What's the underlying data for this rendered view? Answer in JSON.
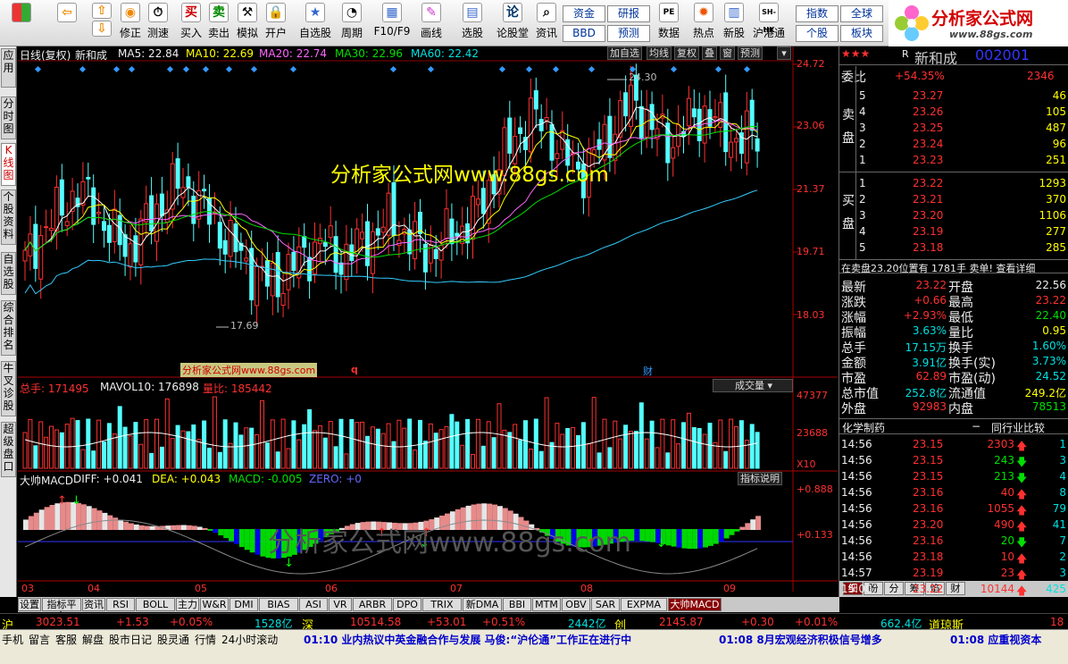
{
  "toolbar": {
    "buttons": [
      "修正",
      "测速",
      "买入",
      "卖出",
      "模拟",
      "开户",
      "自选股",
      "周期",
      "F10/F9",
      "画线",
      "选股",
      "论股堂",
      "资讯",
      "数据",
      "热点",
      "新股",
      "沪港通"
    ],
    "small": [
      "资金",
      "BBD",
      "研报",
      "预测",
      "指数",
      "个股",
      "全球",
      "板块"
    ]
  },
  "logo": {
    "title": "分析家公式网",
    "url": "www.88gs.com"
  },
  "left_tabs": [
    "应用",
    "分时图",
    "K线图",
    "个股资料",
    "自选股",
    "综合排名",
    "牛叉诊股",
    "超级盘口"
  ],
  "chart": {
    "header": {
      "label": "日线(复权)",
      "name": "新和成",
      "ma5": "MA5: 22.84",
      "ma10": "MA10: 22.69",
      "ma20": "MA20: 22.74",
      "ma30": "MA30: 22.96",
      "ma60": "MA60: 22.42"
    },
    "header_buttons": [
      "加自选",
      "均线",
      "复权",
      "叠",
      "窗",
      "预测"
    ],
    "price_axis": [
      "24.72",
      "23.06",
      "21.37",
      "19.71",
      "18.03"
    ],
    "high_label": "24.30",
    "low_label": "17.69",
    "watermark": "分析家公式网www.88gs.com",
    "watermark2": "分析家公式网www.88gs.com",
    "small_stamp": "分析家公式网www.88gs.com",
    "event_marks": [
      "q",
      "财"
    ],
    "volume": {
      "zongshou": "总手: 171495",
      "mavol": "MAVOL10: 176898",
      "liangbi": "量比: 185442",
      "menu": "成交量",
      "axis": [
        "47377",
        "23688",
        "X10"
      ]
    },
    "macd": {
      "title": "大帅MACD",
      "diff": "DIFF: +0.041",
      "dea": "DEA: +0.043",
      "macd": "MACD: -0.005",
      "zero": "ZERO: +0",
      "help": "指标说明",
      "axis": [
        "+0.888",
        "+0.133"
      ]
    },
    "months": [
      "03",
      "04",
      "05",
      "06",
      "07",
      "08",
      "09"
    ]
  },
  "chart_data": {
    "type": "candlestick",
    "title": "新和成 日线(复权)",
    "ylim": [
      17.0,
      25.0
    ],
    "high": 24.3,
    "low": 17.69,
    "months": [
      "03",
      "04",
      "05",
      "06",
      "07",
      "08",
      "09"
    ],
    "closes": [
      19.2,
      20.1,
      20.6,
      21.2,
      20.8,
      19.9,
      19.6,
      20.3,
      21.0,
      21.4,
      20.9,
      20.2,
      19.6,
      19.0,
      18.6,
      18.9,
      19.4,
      19.8,
      19.3,
      19.6,
      20.0,
      20.4,
      19.9,
      19.5,
      19.8,
      20.2,
      20.6,
      21.8,
      22.6,
      23.3,
      22.9,
      22.1,
      21.8,
      22.4,
      23.2,
      23.8,
      22.9,
      22.6,
      23.1,
      23.4,
      22.9,
      22.6,
      22.84
    ],
    "ma_lines": {
      "MA5": 22.84,
      "MA10": 22.69,
      "MA20": 22.74,
      "MA30": 22.96,
      "MA60": 22.42
    }
  },
  "right": {
    "stock_name": "新和成",
    "stock_code": "002001",
    "weibi_label": "委比",
    "weibi_val": "+54.35%",
    "weibi_num": "2346",
    "sell": [
      [
        "5",
        "23.27",
        "46"
      ],
      [
        "4",
        "23.26",
        "105"
      ],
      [
        "3",
        "23.25",
        "487"
      ],
      [
        "2",
        "23.24",
        "96"
      ],
      [
        "1",
        "23.23",
        "251"
      ]
    ],
    "buy": [
      [
        "1",
        "23.22",
        "1293"
      ],
      [
        "2",
        "23.21",
        "370"
      ],
      [
        "3",
        "23.20",
        "1106"
      ],
      [
        "4",
        "23.19",
        "277"
      ],
      [
        "5",
        "23.18",
        "285"
      ]
    ],
    "sell_label": "卖盘",
    "buy_label": "买盘",
    "notice": "在卖盘23.20位置有 1781手 卖单! 查看详细",
    "quote": [
      [
        "最新",
        "23.22",
        "开盘",
        "22.56"
      ],
      [
        "涨跌",
        "+0.66",
        "最高",
        "23.22"
      ],
      [
        "涨幅",
        "+2.93%",
        "最低",
        "22.40"
      ],
      [
        "振幅",
        "3.63%",
        "量比",
        "0.95"
      ],
      [
        "总手",
        "17.15万",
        "换手",
        "1.60%"
      ],
      [
        "金额",
        "3.91亿",
        "换手(实)",
        "3.73%"
      ],
      [
        "市盈",
        "62.89",
        "市盈(动)",
        "24.52"
      ],
      [
        "总市值",
        "252.8亿",
        "流通值",
        "249.2亿"
      ],
      [
        "外盘",
        "92983",
        "内盘",
        "78513"
      ]
    ],
    "industry": "化学制药",
    "industry_cmp": "同行业比较",
    "ticks": [
      [
        "14:56",
        "23.15",
        "2303",
        "1"
      ],
      [
        "14:56",
        "23.15",
        "243",
        "3"
      ],
      [
        "14:56",
        "23.15",
        "213",
        "4"
      ],
      [
        "14:56",
        "23.16",
        "40",
        "8"
      ],
      [
        "14:56",
        "23.16",
        "1055",
        "79"
      ],
      [
        "14:56",
        "23.20",
        "490",
        "41"
      ],
      [
        "14:56",
        "23.16",
        "20",
        "7"
      ],
      [
        "14:56",
        "23.18",
        "10",
        "2"
      ],
      [
        "14:57",
        "23.19",
        "23",
        "3"
      ],
      [
        "15:00",
        "23.22",
        "10144",
        "425"
      ]
    ],
    "bottom_tabs": [
      "细",
      "盼",
      "分",
      "筹",
      "焰",
      "财"
    ]
  },
  "bottom_tabs": [
    "设置",
    "指标平台",
    "资讯",
    "RSI",
    "BOLL",
    "主力",
    "W&R",
    "DMI",
    "BIAS",
    "ASI",
    "VR",
    "ARBR",
    "DPO",
    "TRIX",
    "新DMA",
    "BBI",
    "MTM",
    "OBV",
    "SAR",
    "EXPMA",
    "大帅MACD"
  ],
  "status1": {
    "sh_label": "沪",
    "sh": "3023.51",
    "sh_chg": "+1.53",
    "sh_pct": "+0.05%",
    "sh_amt": "1528亿",
    "sz_label": "深",
    "sz": "10514.58",
    "sz_chg": "+53.01",
    "sz_pct": "+0.51%",
    "sz_amt": "2442亿",
    "cy_label": "创",
    "cy": "2145.87",
    "cy_chg": "+0.30",
    "cy_pct": "+0.01%",
    "cy_amt": "662.4亿",
    "dj_label": "道琼斯",
    "dj": "18"
  },
  "status2": {
    "left": [
      "手机",
      "留言",
      "客服",
      "解盘",
      "股市日记",
      "股灵通",
      "行情",
      "24小时滚动"
    ],
    "news1": "01:10 业内热议中英金融合作与发展 马俊:“沪伦通”工作正在进行中",
    "news2": "01:08 8月宏观经济积极信号增多",
    "news3": "01:08 应重视资本"
  }
}
